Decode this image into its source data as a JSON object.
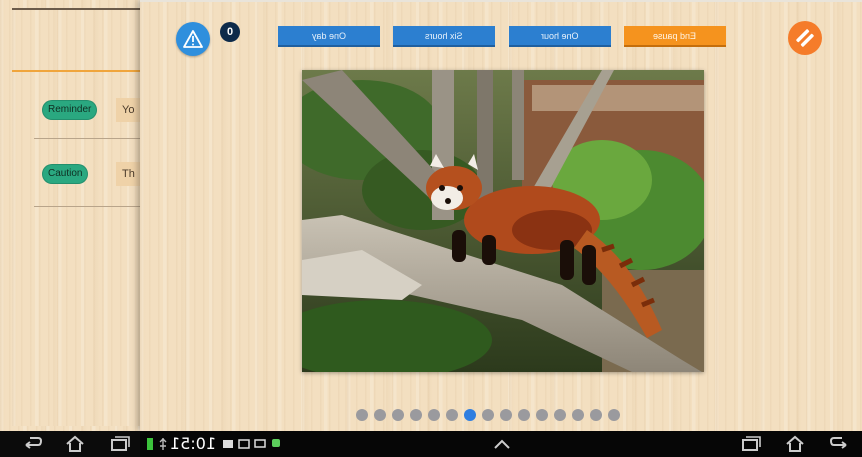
{
  "back_panel": {
    "rows": [
      {
        "badge": "Reminder",
        "text": "Yo"
      },
      {
        "badge": "Caution",
        "text": "Th"
      }
    ]
  },
  "toolbar": {
    "alert_count": "0",
    "durations": [
      {
        "label": "One day"
      },
      {
        "label": "Six hours"
      },
      {
        "label": "One hour"
      },
      {
        "label": "End pause"
      }
    ]
  },
  "carousel": {
    "total": 15,
    "active_index": 6
  },
  "status_bar": {
    "time": "10:51"
  },
  "colors": {
    "blue": "#2c7fd0",
    "orange": "#f5931e",
    "green_pill": "#2aa880"
  },
  "icons": [
    "warning-icon",
    "pause-icon",
    "back-icon",
    "home-icon",
    "recent-apps-icon",
    "chevron-up-icon"
  ]
}
